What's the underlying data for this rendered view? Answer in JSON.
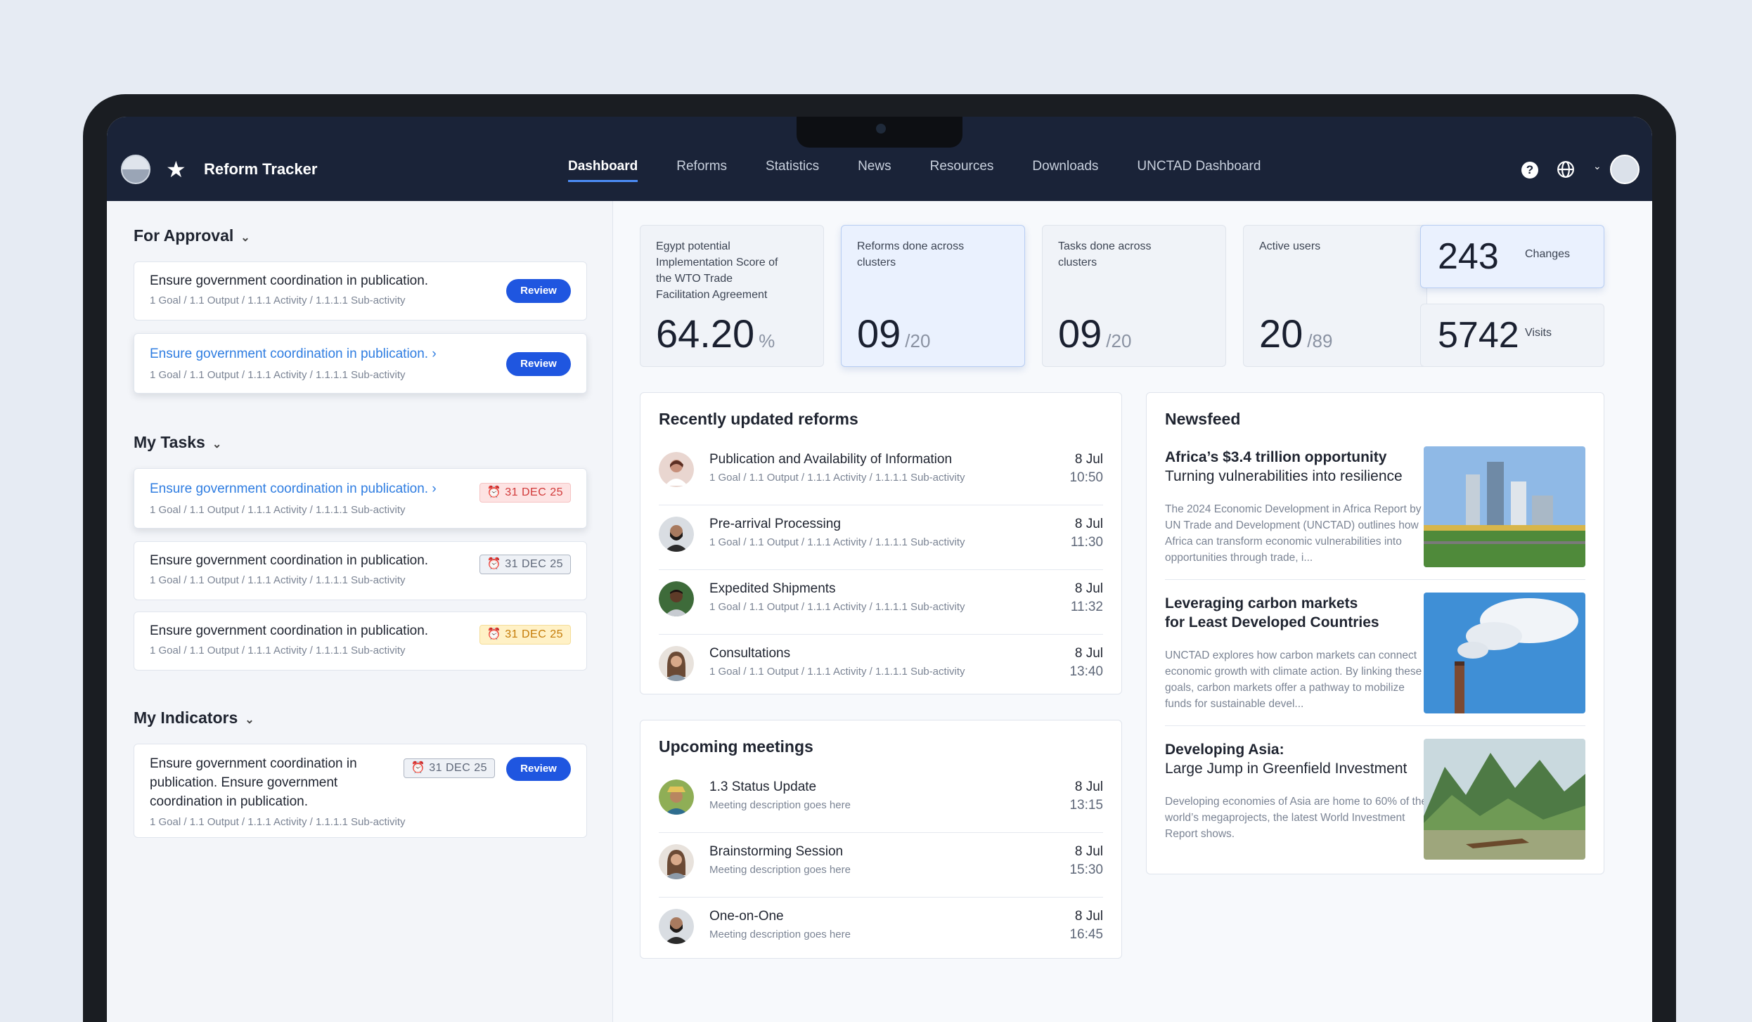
{
  "header": {
    "brand": "Reform Tracker",
    "nav": [
      "Dashboard",
      "Reforms",
      "Statistics",
      "News",
      "Resources",
      "Downloads",
      "UNCTAD Dashboard"
    ],
    "active_nav": "Dashboard",
    "help_glyph": "?"
  },
  "sidebar": {
    "approval": {
      "title": "For Approval",
      "items": [
        {
          "title": "Ensure government coordination in publication.",
          "crumbs": "1 Goal  /  1.1 Output  /  1.1.1 Activity  /  1.1.1.1 Sub-activity",
          "button": "Review"
        },
        {
          "title": "Ensure government coordination in publication.  ›",
          "crumbs": "1 Goal  /  1.1 Output  /  1.1.1 Activity  /  1.1.1.1 Sub-activity",
          "button": "Review"
        }
      ]
    },
    "tasks": {
      "title": "My Tasks",
      "items": [
        {
          "title": "Ensure government coordination in publication.  ›",
          "crumbs": "1 Goal  /  1.1 Output  /  1.1.1 Activity  /  1.1.1.1 Sub-activity",
          "due": "⏰ 31 DEC 25"
        },
        {
          "title": "Ensure government coordination in publication.",
          "crumbs": "1 Goal  /  1.1 Output  /  1.1.1 Activity  /  1.1.1.1 Sub-activity",
          "due": "⏰ 31 DEC 25"
        },
        {
          "title": "Ensure government coordination in publication.",
          "crumbs": "1 Goal  /  1.1 Output  /  1.1.1 Activity  /  1.1.1.1 Sub-activity",
          "due": "⏰ 31 DEC 25"
        }
      ]
    },
    "indicators": {
      "title": "My Indicators",
      "items": [
        {
          "title_l1": "Ensure government coordination in",
          "title_l2": "publication. Ensure government",
          "title_l3": "coordination in publication.",
          "crumbs": "1 Goal  /  1.1 Output  /  1.1.1 Activity  /  1.1.1.1 Sub-activity",
          "due": "⏰ 31 DEC 25",
          "button": "Review"
        }
      ]
    }
  },
  "stats": [
    {
      "label": "Egypt potential Implementation Score of the WTO Trade Facilitation Agreement",
      "value": "64.20",
      "suffix": "%"
    },
    {
      "label": "Reforms done across clusters",
      "value": "09",
      "suffix": "/20"
    },
    {
      "label": "Tasks done across clusters",
      "value": "09",
      "suffix": "/20"
    },
    {
      "label": "Active users",
      "value": "20",
      "suffix": "/89"
    }
  ],
  "mini_stats": [
    {
      "value": "243",
      "label": "Changes"
    },
    {
      "value": "5742",
      "label": "Visits"
    }
  ],
  "reforms": {
    "title": "Recently updated reforms",
    "items": [
      {
        "title": "Publication and Availability of Information",
        "crumbs": "1 Goal  /  1.1 Output  /  1.1.1 Activity  /  1.1.1.1 Sub-activity",
        "date": "8 Jul",
        "time": "10:50"
      },
      {
        "title": "Pre-arrival Processing",
        "crumbs": "1 Goal  /  1.1 Output  /  1.1.1 Activity  /  1.1.1.1 Sub-activity",
        "date": "8 Jul",
        "time": "11:30"
      },
      {
        "title": "Expedited Shipments",
        "crumbs": "1 Goal  /  1.1 Output  /  1.1.1 Activity  /  1.1.1.1 Sub-activity",
        "date": "8 Jul",
        "time": "11:32"
      },
      {
        "title": "Consultations",
        "crumbs": "1 Goal  /  1.1 Output  /  1.1.1 Activity  /  1.1.1.1 Sub-activity",
        "date": "8 Jul",
        "time": "13:40"
      }
    ]
  },
  "meetings": {
    "title": "Upcoming meetings",
    "items": [
      {
        "title": "1.3 Status Update",
        "desc": "Meeting description goes here",
        "date": "8 Jul",
        "time": "13:15"
      },
      {
        "title": "Brainstorming Session",
        "desc": "Meeting description goes here",
        "date": "8 Jul",
        "time": "15:30"
      },
      {
        "title": "One-on-One",
        "desc": "Meeting description goes here",
        "date": "8 Jul",
        "time": "16:45"
      }
    ]
  },
  "newsfeed": {
    "title": "Newsfeed",
    "items": [
      {
        "headline": "Africa’s $3.4 trillion opportunity",
        "subhead": "Turning vulnerabilities into resilience",
        "desc": "The 2024 Economic Development in Africa Report by UN Trade and Development (UNCTAD) outlines how Africa can transform economic vulnerabilities into opportunities through trade, i..."
      },
      {
        "headline": "Leveraging carbon markets",
        "subhead": "for Least Developed Countries",
        "desc": "UNCTAD explores how carbon markets can connect economic growth with climate action. By linking these goals, carbon markets offer a pathway to mobilize funds for sustainable devel..."
      },
      {
        "headline": "Developing Asia:",
        "subhead": "Large Jump in Greenfield Investment",
        "desc": "Developing economies of Asia are home to 60% of the world’s megaprojects, the latest World Investment Report shows."
      }
    ]
  }
}
